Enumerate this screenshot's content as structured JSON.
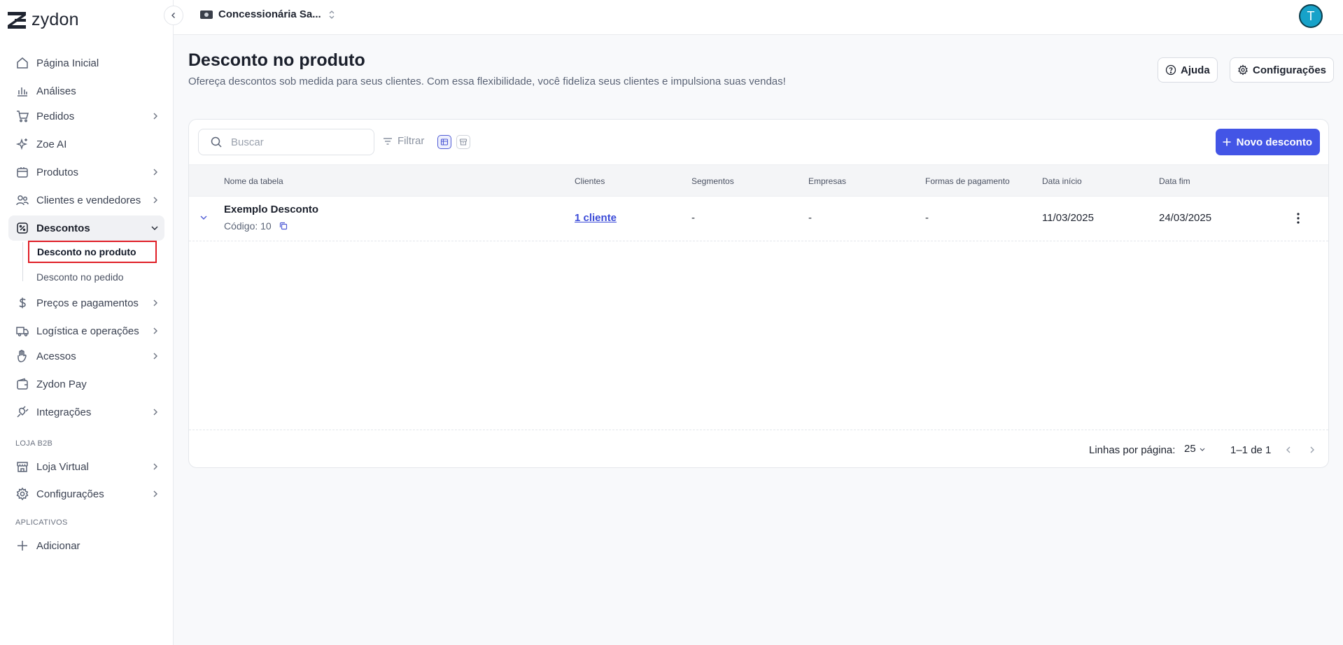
{
  "brand": {
    "name": "zydon",
    "accent": "#4355e6"
  },
  "topbar": {
    "org_name": "Concessionária Sa...",
    "avatar_initial": "T"
  },
  "sidebar": {
    "items": [
      {
        "label": "Página Inicial",
        "icon": "home-icon"
      },
      {
        "label": "Análises",
        "icon": "chart-bars-icon"
      },
      {
        "label": "Pedidos",
        "icon": "cart-icon"
      },
      {
        "label": "Zoe AI",
        "icon": "sparkle-icon"
      },
      {
        "label": "Produtos",
        "icon": "box-icon"
      },
      {
        "label": "Clientes e vendedores",
        "icon": "users-icon"
      },
      {
        "label": "Descontos",
        "icon": "discount-icon"
      },
      {
        "label": "Preços e pagamentos",
        "icon": "dollar-icon"
      },
      {
        "label": "Logística e operações",
        "icon": "truck-icon"
      },
      {
        "label": "Acessos",
        "icon": "hand-icon"
      },
      {
        "label": "Zydon Pay",
        "icon": "wallet-icon"
      },
      {
        "label": "Integrações",
        "icon": "plug-icon"
      },
      {
        "label": "Loja Virtual",
        "icon": "store-icon"
      },
      {
        "label": "Configurações",
        "icon": "gear-icon"
      },
      {
        "label": "Adicionar",
        "icon": "plus-icon"
      }
    ],
    "sub_items": [
      {
        "label": "Desconto no produto"
      },
      {
        "label": "Desconto no pedido"
      }
    ],
    "sections": {
      "store": "LOJA B2B",
      "apps": "APLICATIVOS"
    }
  },
  "header": {
    "title": "Desconto no produto",
    "subtitle": "Ofereça descontos sob medida para seus clientes. Com essa flexibilidade, você fideliza seus clientes e impulsiona suas vendas!",
    "help_label": "Ajuda",
    "settings_label": "Configurações"
  },
  "toolbar": {
    "search_placeholder": "Buscar",
    "filter_label": "Filtrar",
    "new_label": "Novo desconto"
  },
  "table": {
    "columns": [
      "Nome da tabela",
      "Clientes",
      "Segmentos",
      "Empresas",
      "Formas de pagamento",
      "Data início",
      "Data fim"
    ],
    "rows": [
      {
        "name": "Exemplo Desconto",
        "code": "Código: 10",
        "clients": "1 cliente",
        "segments": "-",
        "companies": "-",
        "payments": "-",
        "start": "11/03/2025",
        "end": "24/03/2025"
      }
    ]
  },
  "pagination": {
    "rows_label": "Linhas por página:",
    "rows_value": "25",
    "range": "1–1 de 1"
  }
}
